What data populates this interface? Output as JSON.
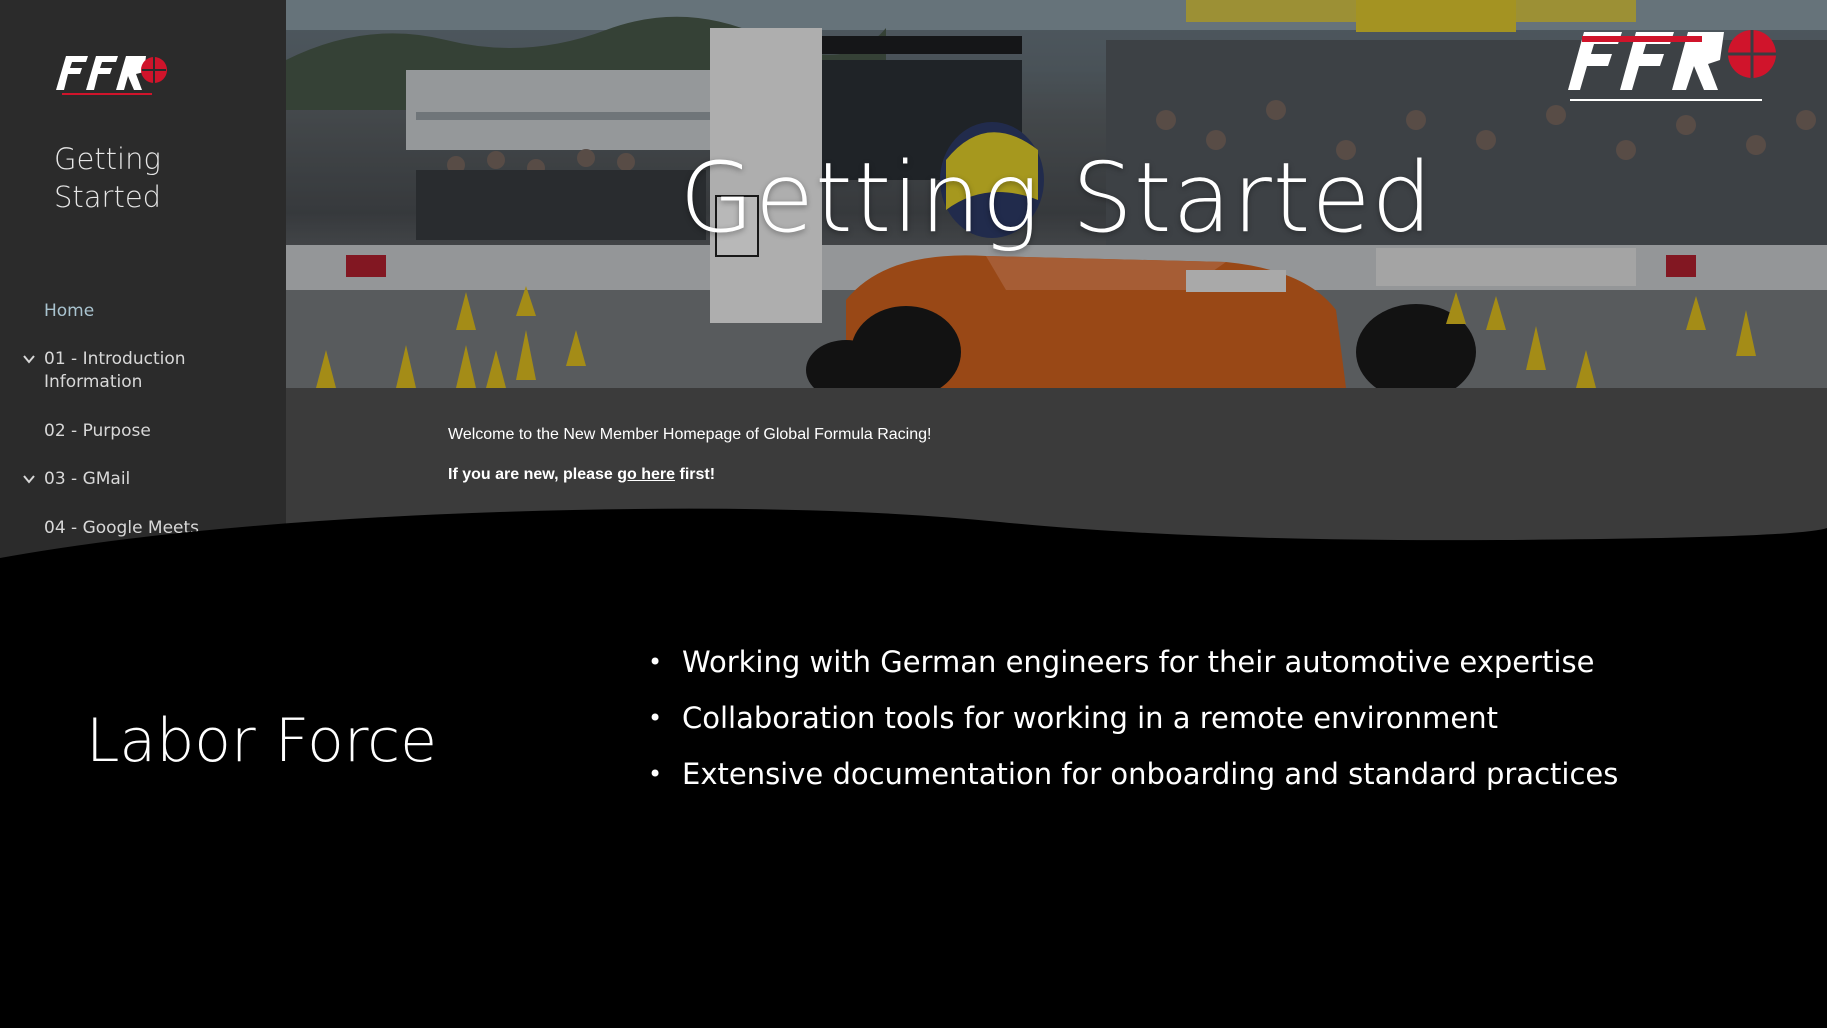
{
  "colors": {
    "sidebar_bg": "#2b2b2b",
    "content_bg": "#3b3b3b",
    "slide_bg": "#000000",
    "home_link": "#a9c3cf",
    "brand_red": "#d0142b"
  },
  "sidebar": {
    "logo_icon": "gfr-logo-icon",
    "title": "Getting Started",
    "nav": [
      {
        "label": "Home",
        "expandable": false,
        "active": true
      },
      {
        "label": "01 - Introduction Information",
        "expandable": true
      },
      {
        "label": "02 - Purpose",
        "expandable": false
      },
      {
        "label": "03 - GMail",
        "expandable": true
      },
      {
        "label": "04 - Google Meets",
        "expandable": false
      }
    ]
  },
  "hero": {
    "title": "Getting Started",
    "logo_icon": "gfr-logo-icon"
  },
  "content": {
    "welcome": "Welcome to the New Member Homepage of Global Formula Racing!",
    "new_prefix": "If you are new, please ",
    "new_link": "go here",
    "new_suffix": " first!"
  },
  "slide": {
    "title": "Labor Force",
    "bullets": [
      "Working with German engineers for their automotive expertise",
      "Collaboration tools for working in a remote environment",
      "Extensive documentation for onboarding and standard practices"
    ]
  }
}
